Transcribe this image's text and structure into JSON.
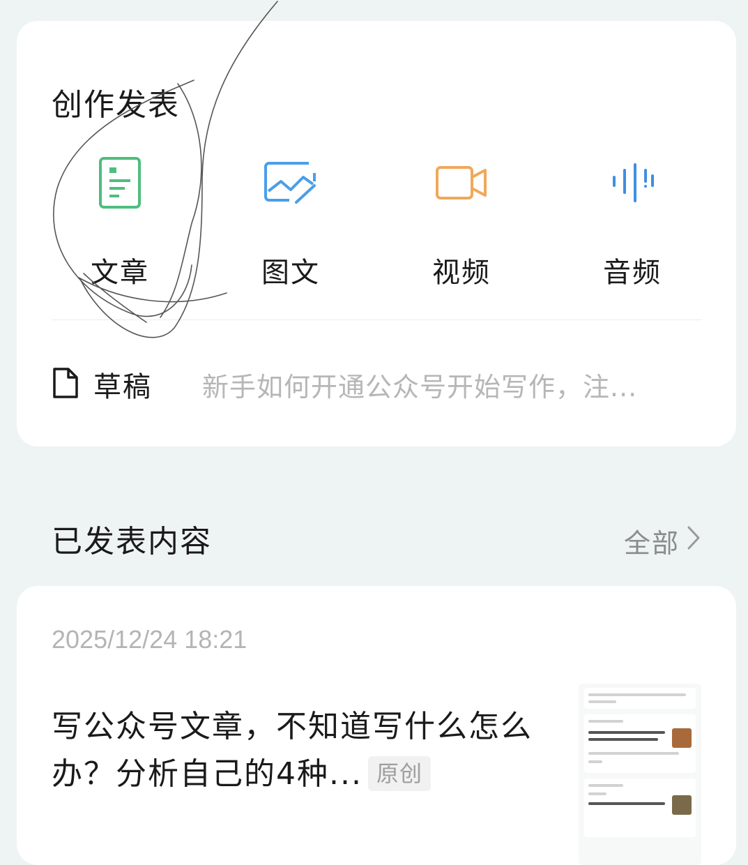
{
  "create": {
    "title": "创作发表",
    "tools": [
      {
        "label": "文章",
        "icon": "article-icon",
        "color": "#4fbd7e"
      },
      {
        "label": "图文",
        "icon": "image-text-icon",
        "color": "#4b9ee8"
      },
      {
        "label": "视频",
        "icon": "video-camera-icon",
        "color": "#f0a85a"
      },
      {
        "label": "音频",
        "icon": "audio-wave-icon",
        "color": "#3f8fe0"
      }
    ],
    "draft": {
      "label": "草稿",
      "preview": "新手如何开通公众号开始写作，注..."
    }
  },
  "published": {
    "title": "已发表内容",
    "all_label": "全部",
    "posts": [
      {
        "date": "2025/12/24 18:21",
        "title": "写公众号文章，不知道写什么怎么办？分析自己的4种...",
        "badge": "原创"
      }
    ]
  }
}
